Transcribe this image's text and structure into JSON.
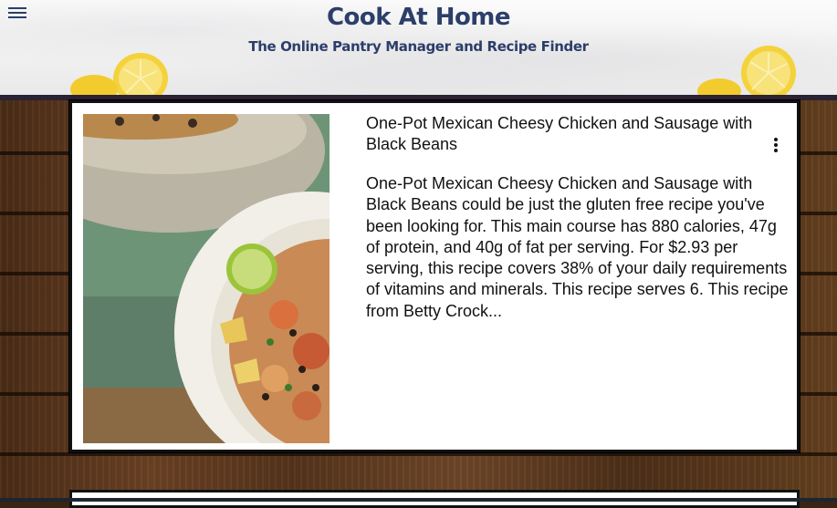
{
  "header": {
    "title": "Cook At Home",
    "subtitle": "The Online Pantry Manager and Recipe Finder",
    "menu_icon": "hamburger-menu-icon"
  },
  "recipe_card": {
    "title": "One-Pot Mexican Cheesy Chicken and Sausage with Black Beans",
    "description": "One-Pot Mexican Cheesy Chicken and Sausage with Black Beans could be just the gluten free recipe you've been looking for. This main course has 880 calories, 47g of protein, and 40g of fat per serving. For $2.93 per serving, this recipe covers 38% of your daily requirements of vitamins and minerals. This recipe serves 6. This recipe from Betty Crock...",
    "options_icon": "more-vertical-icon"
  },
  "colors": {
    "brand": "#2c3e69",
    "card_border": "#111111"
  }
}
